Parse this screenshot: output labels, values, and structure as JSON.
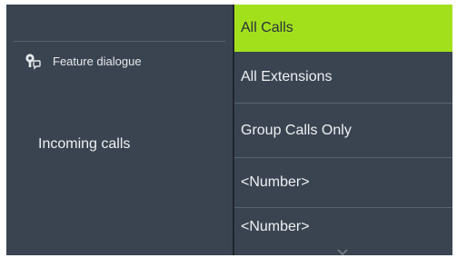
{
  "left_panel": {
    "feature_label": "Feature dialogue",
    "feature_icon": "feature-dialogue-icon",
    "incoming_label": "Incoming calls"
  },
  "menu": {
    "items": [
      {
        "label": "All Calls",
        "selected": true
      },
      {
        "label": "All Extensions",
        "selected": false
      },
      {
        "label": "Group Calls Only",
        "selected": false
      },
      {
        "label": "<Number>",
        "selected": false
      },
      {
        "label": "<Number>",
        "selected": false
      }
    ],
    "scroll_icon": "chevron-down-icon"
  },
  "colors": {
    "background": "#3a4451",
    "selected": "#a3e01c",
    "text": "#eef0f2",
    "separator": "#59636f"
  }
}
